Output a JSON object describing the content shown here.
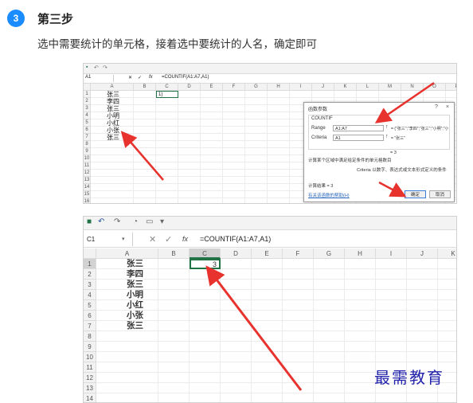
{
  "step": {
    "number": "3",
    "title": "第三步",
    "description": "选中需要统计的单元格，接着选中要统计的人名，确定即可"
  },
  "names": [
    "张三",
    "李四",
    "张三",
    "小明",
    "小红",
    "小张",
    "张三"
  ],
  "columns": [
    "A",
    "B",
    "C",
    "D",
    "E",
    "F",
    "G",
    "H",
    "I",
    "J",
    "K",
    "L",
    "M",
    "N",
    "O",
    "P"
  ],
  "shot1": {
    "name_box": "A1",
    "formula": "=COUNTIF(A1:A7,A1)",
    "formula_c1": "1)",
    "fx": "fx",
    "dialog": {
      "title": "函数参数",
      "help": "?",
      "close": "×",
      "function_name": "COUNTIF",
      "range_label": "Range",
      "range_value": "A1:A7",
      "range_result": "= {\"张三\";\"李四\";\"张三\";\"小明\";\"小",
      "criteria_label": "Criteria",
      "criteria_value": "A1",
      "criteria_result": "= \"张三\"",
      "result_eq": "= 3",
      "desc": "计算某个区域中满足给定条件的单元格数目",
      "criteria_help": "Criteria  以数字、表达式或文本形式定义的条件",
      "calc_result": "计算结果 = 3",
      "help_link": "有关该函数的帮助(H)",
      "ok": "确定",
      "cancel": "取消"
    }
  },
  "shot2": {
    "name_box": "C1",
    "formula": "=COUNTIF(A1:A7,A1)",
    "fx": "fx",
    "c1_value": "3",
    "rows": [
      "1",
      "2",
      "3",
      "4",
      "5",
      "6",
      "7",
      "8",
      "9",
      "10",
      "11",
      "12",
      "13",
      "14"
    ],
    "columns": [
      "A",
      "B",
      "C",
      "D",
      "E",
      "F",
      "G",
      "H",
      "I",
      "J",
      "K"
    ]
  },
  "watermark": "最需教育",
  "colors": {
    "accent": "#1a8cff",
    "arrow": "#e8322d",
    "selection": "#217346"
  }
}
